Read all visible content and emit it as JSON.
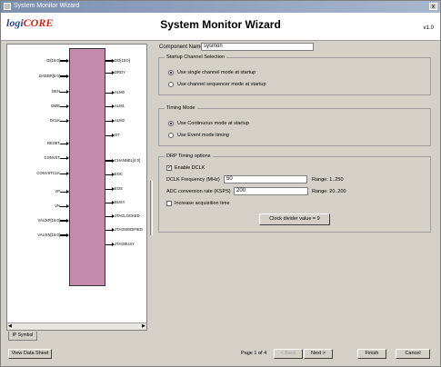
{
  "window": {
    "title": "System Monitor Wizard",
    "close_glyph": "x"
  },
  "header": {
    "logo_a": "logi",
    "logo_b": "CORE",
    "title": "System Monitor Wizard",
    "version": "v1.0"
  },
  "symbol": {
    "left_pins": [
      {
        "label": "DI[15:0]",
        "bus": true
      },
      {
        "label": "DADDR[6:0]",
        "bus": true
      },
      {
        "label": "DEN",
        "bus": false
      },
      {
        "label": "DWE",
        "bus": false
      },
      {
        "label": "DCLK",
        "bus": false
      },
      {
        "label": "RESET",
        "bus": false
      },
      {
        "label": "CONVST",
        "bus": false
      },
      {
        "label": "CONVSTCLK",
        "bus": false
      },
      {
        "label": "VP",
        "bus": false
      },
      {
        "label": "VN",
        "bus": false
      },
      {
        "label": "VAUXP[15:0]",
        "bus": true
      },
      {
        "label": "VAUXN[15:0]",
        "bus": true
      }
    ],
    "right_pins": [
      {
        "label": "DO[15:0]",
        "bus": true
      },
      {
        "label": "DRDY",
        "bus": false
      },
      {
        "label": "ALM0",
        "bus": false
      },
      {
        "label": "ALM1",
        "bus": false
      },
      {
        "label": "ALM2",
        "bus": false
      },
      {
        "label": "OT",
        "bus": false
      },
      {
        "label": "CHANNEL[4:0]",
        "bus": true
      },
      {
        "label": "EOC",
        "bus": false
      },
      {
        "label": "EOS",
        "bus": false
      },
      {
        "label": "BUSY",
        "bus": false
      },
      {
        "label": "JTAGLOCKED",
        "bus": false
      },
      {
        "label": "JTAGMODIFIED",
        "bus": false
      },
      {
        "label": "JTAGBUSY",
        "bus": false
      }
    ],
    "tab_label": "IP Symbol"
  },
  "form": {
    "component_name_label": "Component Name",
    "component_name_value": "sysmon",
    "startup": {
      "title": "Startup Channel Selection",
      "options": [
        {
          "label": "Use single channel mode at startup",
          "selected": true
        },
        {
          "label": "Use channel sequencer mode at startup",
          "selected": false
        }
      ]
    },
    "timing": {
      "title": "Timing Mode",
      "options": [
        {
          "label": "Use Continuous mode at startup",
          "selected": true
        },
        {
          "label": "Use Event mode timing",
          "selected": false
        }
      ]
    },
    "drp": {
      "title": "DRP Timing options",
      "enable_dclk_label": "Enable DCLK",
      "enable_dclk_checked": true,
      "dclk_label": "DCLK Frequency (MHz)",
      "dclk_value": "50",
      "dclk_range": "Range: 1..250",
      "adc_label": "ADC conversion rate (KSPS)",
      "adc_value": "200",
      "adc_range": "Range: 20..200",
      "acq_label": "Increase acquisition time",
      "acq_checked": false,
      "divider_label": "Clock divider value = 9"
    }
  },
  "footer": {
    "datasheet": "View Data Sheet",
    "page": "Page 1 of 4",
    "back": "< Back",
    "next": "Next >",
    "finish": "Finish",
    "cancel": "Cancel"
  }
}
